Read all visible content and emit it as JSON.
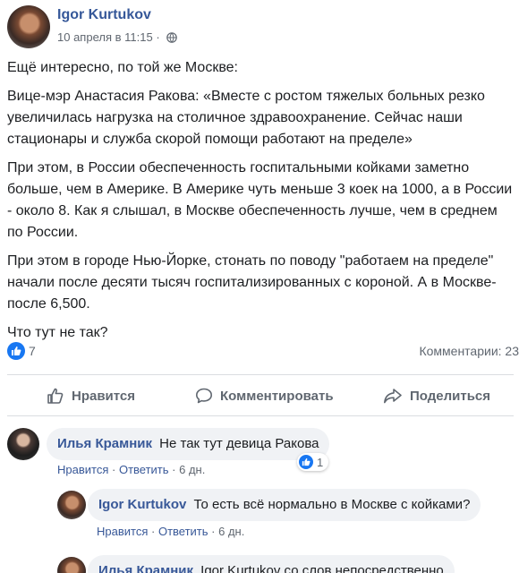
{
  "post": {
    "author": "Igor Kurtukov",
    "timestamp": "10 апреля в 11:15",
    "privacy_icon": "globe-icon",
    "paragraphs": [
      "Ещё интересно, по той же Москве:",
      "Вице-мэр Анастасия Ракова: «Вместе с ростом тяжелых больных резко увеличилась нагрузка на столичное здравоохранение. Сейчас наши стационары и служба скорой помощи работают на пределе»",
      "При этом, в России обеспеченность госпитальными койками заметно больше, чем в Америке. В Америке чуть меньше 3 коек на 1000, а в России - около 8. Как я слышал, в Москве обеспеченность лучше, чем в среднем по России.",
      "При этом в городе Нью-Йорке, стонать по поводу \"работаем на пределе\" начали после десяти тысяч госпитализированных с короной. А в Москве- после 6,500.",
      "Что тут не так?"
    ],
    "likes": "7",
    "comments_label": "Комментарии: 23"
  },
  "actions": {
    "like": "Нравится",
    "comment": "Комментировать",
    "share": "Поделиться"
  },
  "comments": [
    {
      "author": "Илья Крамник",
      "text": "Не так тут девица Ракова",
      "like_label": "Нравится",
      "reply_label": "Ответить",
      "age": "6 дн.",
      "reactions": "1"
    },
    {
      "author": "Igor Kurtukov",
      "text": "То есть всё нормально в Москве с койками?",
      "like_label": "Нравится",
      "reply_label": "Ответить",
      "age": "6 дн."
    },
    {
      "author": "Илья Крамник",
      "text": "Igor Kurtukov со слов непосредственно"
    }
  ],
  "colors": {
    "link": "#365899",
    "accent": "#1877f2",
    "bubble": "#f0f2f5",
    "muted": "#606770"
  }
}
